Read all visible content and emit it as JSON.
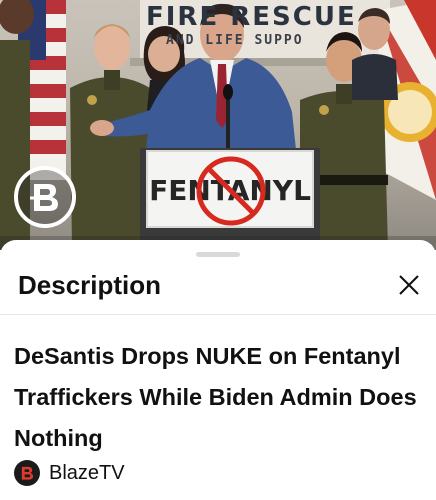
{
  "video": {
    "banner_text": "FIRE RESCUE",
    "sub_banner_text": "AND LIFE SUPPO",
    "podium_sign_text": "FENTANYL",
    "channel_logo_icon": "blaze-b-logo-icon",
    "colors": {
      "suit": "#3c5a96",
      "uniform": "#4a4a2c",
      "no_symbol": "#d62a20"
    }
  },
  "sheet": {
    "title": "Description",
    "close_icon": "close-icon",
    "video_title": "DeSantis Drops NUKE on Fentanyl Traffickers While Biden Admin Does Nothing",
    "channel": {
      "name": "BlazeTV",
      "avatar_icon": "blaze-b-logo-icon",
      "brand_color": "#e03a2f"
    }
  }
}
